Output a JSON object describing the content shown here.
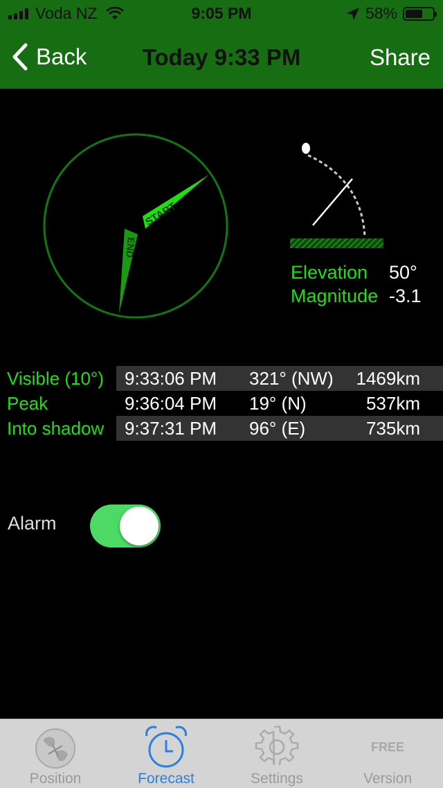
{
  "status_bar": {
    "carrier": "Voda NZ",
    "time": "9:05 PM",
    "battery": "58%"
  },
  "nav": {
    "back_label": "Back",
    "title": "Today 9:33 PM",
    "share_label": "Share"
  },
  "sky_map": {
    "start_label": "START",
    "end_label": "END"
  },
  "readout": {
    "elevation_label": "Elevation",
    "elevation_value": "50°",
    "magnitude_label": "Magnitude",
    "magnitude_value": "-3.1"
  },
  "passes": [
    {
      "label": "Visible (10°)",
      "time": "9:33:06 PM",
      "azimuth": "321° (NW)",
      "distance": "1469km"
    },
    {
      "label": "Peak",
      "time": "9:36:04 PM",
      "azimuth": "19° (N)",
      "distance": "537km"
    },
    {
      "label": "Into shadow",
      "time": "9:37:31 PM",
      "azimuth": "96° (E)",
      "distance": "735km"
    }
  ],
  "alarm": {
    "label": "Alarm",
    "enabled": true
  },
  "tabs": [
    {
      "label": "Position",
      "icon": "globe-icon",
      "active": false
    },
    {
      "label": "Forecast",
      "icon": "alarm-clock-icon",
      "active": true
    },
    {
      "label": "Settings",
      "icon": "gear-icon",
      "active": false
    },
    {
      "label": "Version",
      "icon": "free-badge-icon",
      "badge": "FREE",
      "active": false
    }
  ],
  "colors": {
    "header": "#166d12",
    "accent": "#1de10f",
    "toggle_on": "#4cd964",
    "tab_active": "#2a7fe0"
  }
}
